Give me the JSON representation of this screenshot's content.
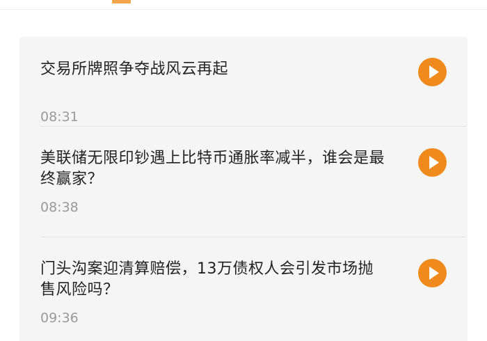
{
  "colors": {
    "accent": "#f08a1c",
    "card_background": "#f5f5f5",
    "title_text": "#222222",
    "time_text": "#9a9a9a"
  },
  "news": {
    "items": [
      {
        "title": "交易所牌照争夺战风云再起",
        "time": "08:31",
        "icon": "play-icon"
      },
      {
        "title": "美联储无限印钞遇上比特币通胀率减半，谁会是最终赢家？",
        "time": "08:38",
        "icon": "play-icon"
      },
      {
        "title": "门头沟案迎清算赔偿，13万债权人会引发市场抛售风险吗？",
        "time": "09:36",
        "icon": "play-icon"
      }
    ]
  }
}
